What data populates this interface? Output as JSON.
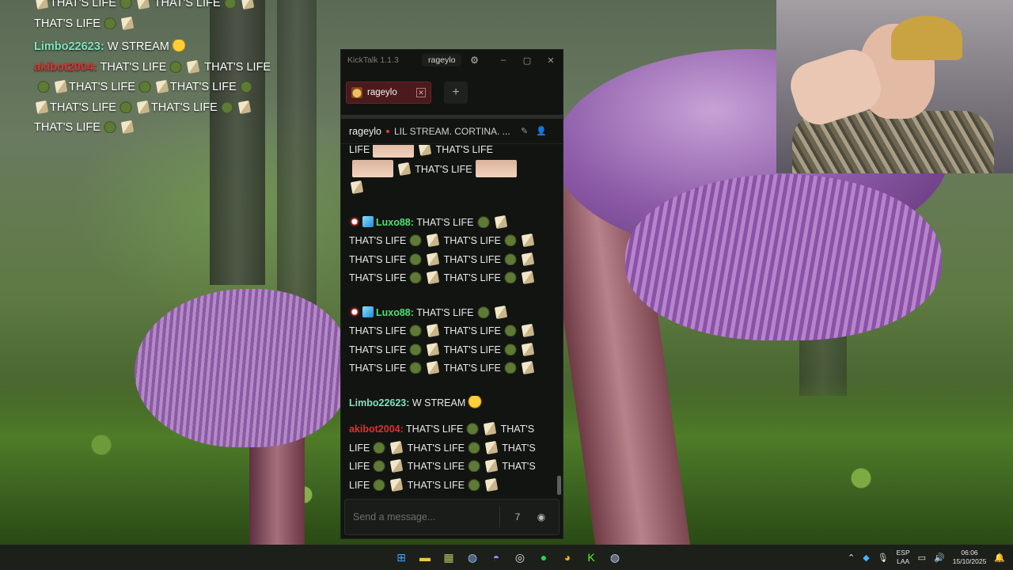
{
  "overlay_chat": {
    "messages": [
      {
        "user": "",
        "parts": [
          "THAT'S LIFE",
          "THAT'S LIFE"
        ]
      },
      {
        "user": "",
        "parts": [
          "THAT'S LIFE"
        ]
      },
      {
        "user": "Limbo22623:",
        "user_color": "#7fe3c0",
        "text": "W STREAM"
      },
      {
        "user": "akibot2004:",
        "user_color": "#e03030",
        "text": "THAT'S LIFE",
        "text2": "THAT'S LIFE"
      },
      {
        "user": "",
        "parts": [
          "THAT'S LIFE",
          "THAT'S LIFE"
        ]
      },
      {
        "user": "",
        "parts": [
          "THAT'S LIFE",
          "THAT'S LIFE"
        ]
      },
      {
        "user": "",
        "parts": [
          "THAT'S LIFE"
        ]
      }
    ]
  },
  "kicktalk": {
    "app_title": "KickTalk 1.1.3",
    "title_channel": "rageylo",
    "window_controls": {
      "minimize": "–",
      "maximize": "▢",
      "close": "✕"
    },
    "tab": {
      "label": "rageylo"
    },
    "add_tab_label": "+",
    "header": {
      "streamer": "rageylo",
      "stream_title": "LIL STREAM. CORTINA. ..."
    },
    "chat": {
      "continued": {
        "line1_a": "LIFE",
        "line1_b": "THAT'S LIFE",
        "line2": "THAT'S LIFE"
      },
      "msg1": {
        "user": "Luxo88:",
        "user_color": "#4fe070",
        "first": "THAT'S LIFE",
        "word": "THAT'S LIFE"
      },
      "msg2": {
        "user": "Luxo88:",
        "user_color": "#4fe070",
        "first": "THAT'S LIFE",
        "word": "THAT'S LIFE"
      },
      "msg3": {
        "user": "Limbo22623:",
        "user_color": "#7fe3c0",
        "text": "W STREAM"
      },
      "msg4": {
        "user": "akibot2004:",
        "user_color": "#e03030",
        "first": "THAT'S LIFE",
        "trail": "THAT'S",
        "lead": "LIFE",
        "word": "THAT'S LIFE"
      }
    },
    "input": {
      "placeholder": "Send a message..."
    }
  },
  "taskbar": {
    "lang_top": "ESP",
    "lang_bottom": "LAA",
    "time": "06:06",
    "date": "15/10/2025"
  },
  "colors": {
    "accent_tab": "#4a1a1c",
    "app_bg": "#121412"
  }
}
